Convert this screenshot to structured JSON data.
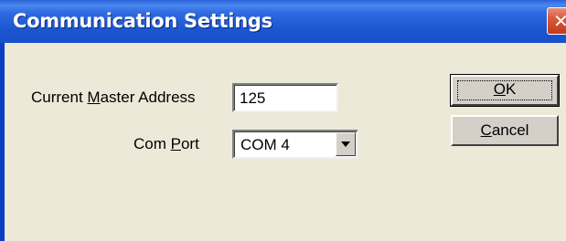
{
  "window": {
    "title": "Communication Settings",
    "close_label": "✕"
  },
  "form": {
    "master_address_label_pre": "Current ",
    "master_address_label_mnemonic": "M",
    "master_address_label_post": "aster Address",
    "master_address_value": "125",
    "com_port_label_pre": "Com ",
    "com_port_label_mnemonic": "P",
    "com_port_label_post": "ort",
    "com_port_value": "COM 4"
  },
  "buttons": {
    "ok_mnemonic": "O",
    "ok_rest": "K",
    "cancel_mnemonic": "C",
    "cancel_rest": "ancel"
  },
  "colors": {
    "titlebar": "#1b55d0",
    "dialog_bg": "#ece9d8",
    "close": "#c4391b"
  }
}
